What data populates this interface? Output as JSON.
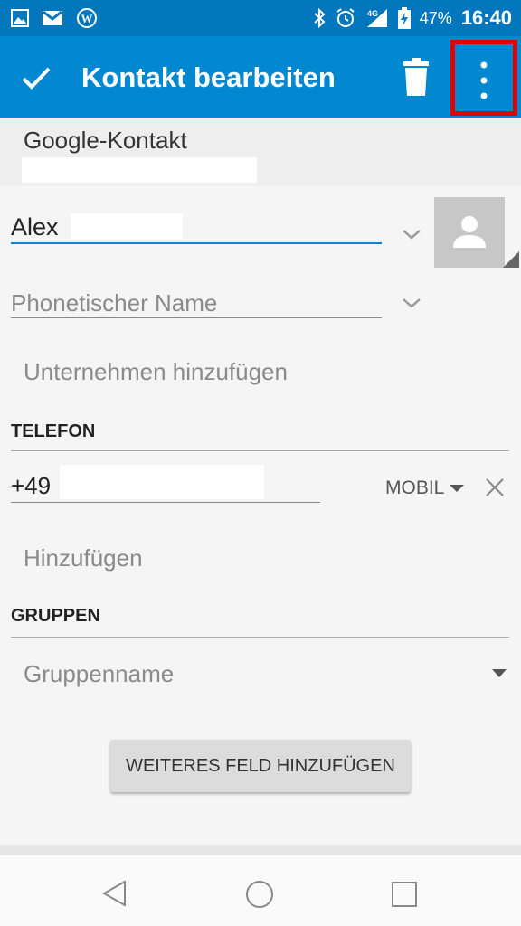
{
  "status_bar": {
    "battery_percent": "47%",
    "time": "16:40",
    "network": "4G",
    "icons_left": [
      "image-icon",
      "gmail-icon",
      "wordpress-icon"
    ],
    "icons_right": [
      "bluetooth-icon",
      "alarm-icon",
      "signal-icon",
      "battery-charging-icon"
    ]
  },
  "app_bar": {
    "title": "Kontakt bearbeiten",
    "confirm_icon": "check-icon",
    "delete_icon": "trash-icon",
    "menu_icon": "more-vert-icon",
    "background": "#0288d1",
    "highlight_color": "#e00000"
  },
  "account": {
    "label": "Google-Kontakt"
  },
  "name": {
    "value": "Alex",
    "phonetic_placeholder": "Phonetischer Name"
  },
  "company": {
    "add_label": "Unternehmen hinzufügen"
  },
  "phone_section": {
    "heading": "TELEFON",
    "number_prefix": "+49",
    "type": "MOBIL",
    "add_label": "Hinzufügen"
  },
  "groups_section": {
    "heading": "GRUPPEN",
    "placeholder": "Gruppenname"
  },
  "more_fields_button": {
    "label": "WEITERES FELD HINZUFÜGEN"
  },
  "nav_bar": {
    "icons": [
      "back-icon",
      "home-icon",
      "recents-icon"
    ]
  }
}
